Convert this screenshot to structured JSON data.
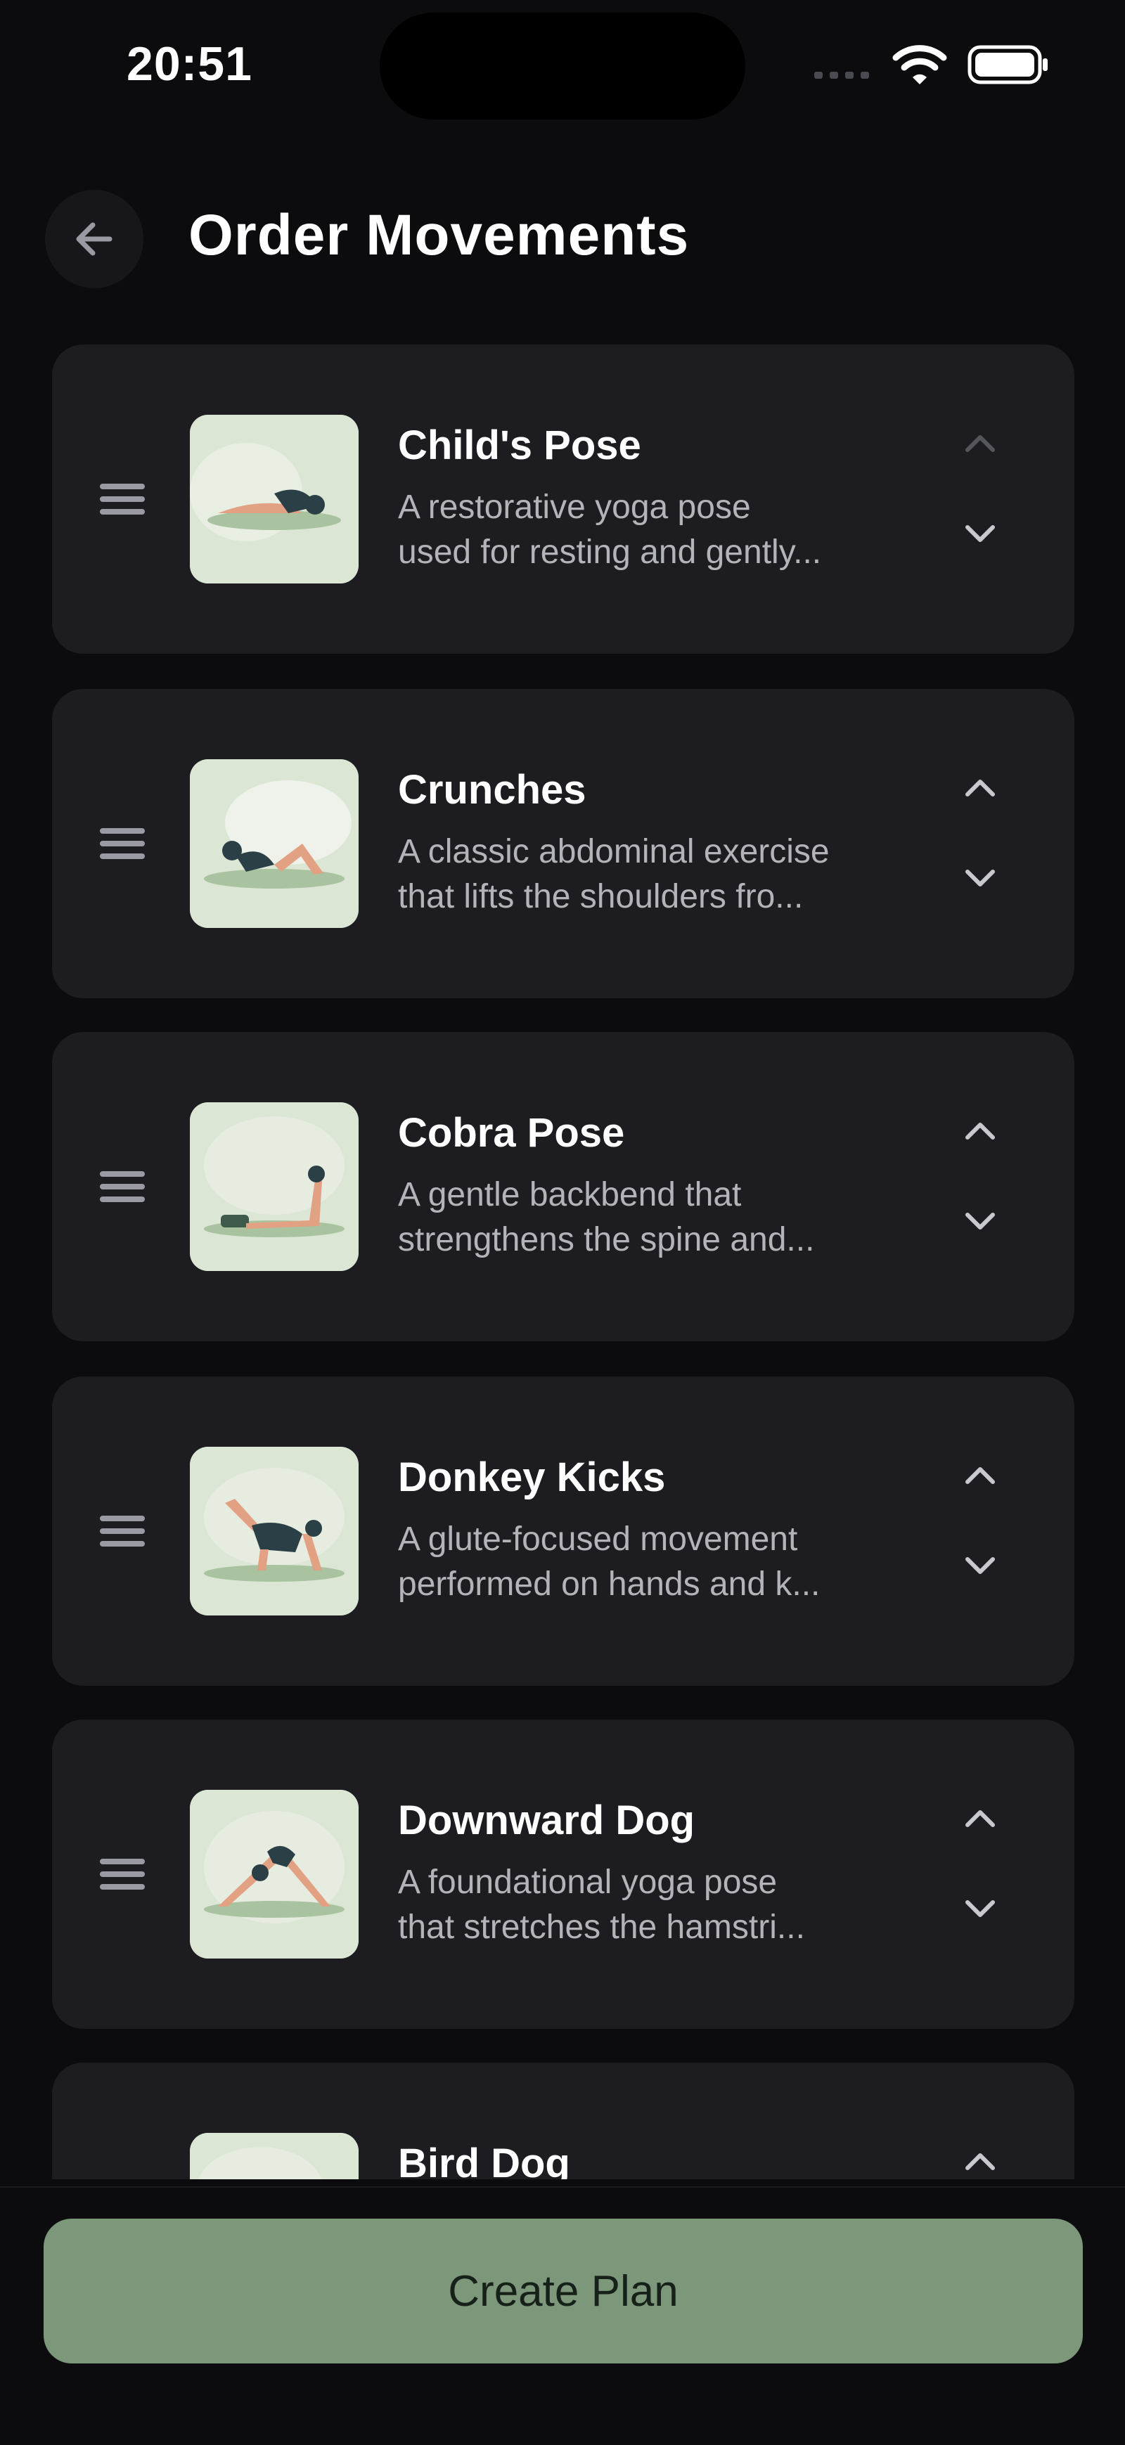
{
  "status_bar": {
    "time": "20:51"
  },
  "header": {
    "title": "Order Movements",
    "back_icon": "arrow-left-icon"
  },
  "movements": [
    {
      "title": "Child's Pose",
      "desc_line1": "A restorative yoga pose",
      "desc_line2": "used for resting and gently...",
      "up_enabled": false
    },
    {
      "title": "Crunches",
      "desc_line1": "A classic abdominal exercise",
      "desc_line2": "that lifts the shoulders fro...",
      "up_enabled": true
    },
    {
      "title": "Cobra Pose",
      "desc_line1": "A gentle backbend that",
      "desc_line2": "strengthens the spine and...",
      "up_enabled": true
    },
    {
      "title": "Donkey Kicks",
      "desc_line1": "A glute-focused movement",
      "desc_line2": "performed on hands and k...",
      "up_enabled": true
    },
    {
      "title": "Downward Dog",
      "desc_line1": "A foundational yoga pose",
      "desc_line2": "that stretches the hamstri...",
      "up_enabled": true
    },
    {
      "title": "Bird Dog",
      "desc_line1": "",
      "desc_line2": "",
      "up_enabled": true
    }
  ],
  "footer": {
    "create_plan_label": "Create Plan"
  },
  "colors": {
    "background": "#0c0c0f",
    "card": "#1c1c21",
    "accent": "#7d977b",
    "thumb_bg": "#dbe6d4"
  }
}
